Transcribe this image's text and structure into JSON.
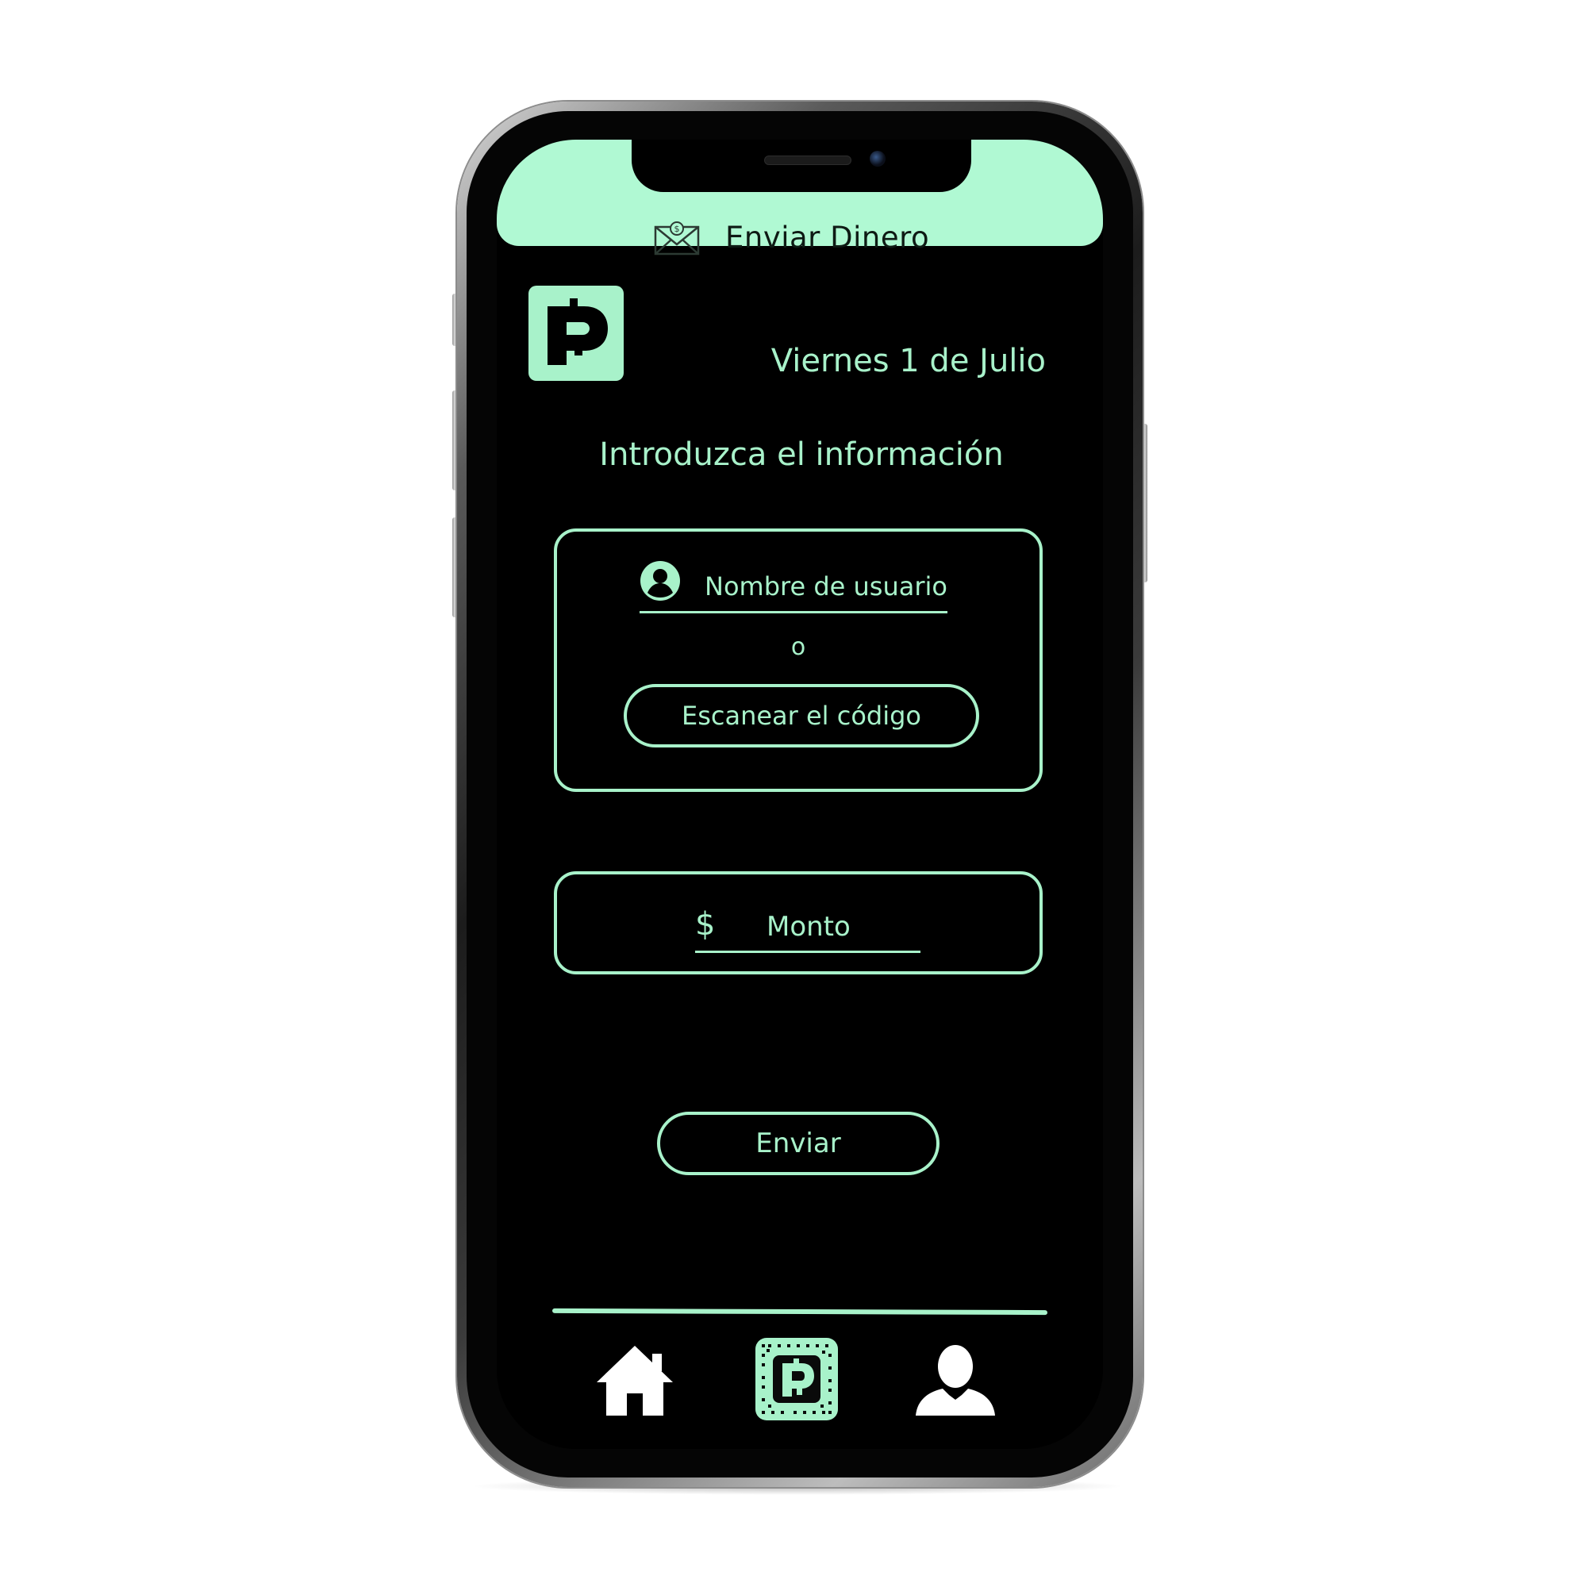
{
  "header": {
    "title": "Enviar Dinero",
    "icon": "money-envelope-icon",
    "background": "#b0f9d3"
  },
  "date": "Viernes 1 de Julio",
  "prompt": "Introduzca el información",
  "recipient": {
    "username_placeholder": "Nombre de usuario",
    "icon": "user-circle-icon",
    "separator": "o",
    "scan_button_label": "Escanear el código"
  },
  "amount": {
    "currency_symbol": "$",
    "placeholder": "Monto"
  },
  "send_button_label": "Enviar",
  "bottom_nav": {
    "items": [
      {
        "name": "home",
        "icon": "home-icon"
      },
      {
        "name": "pay",
        "icon": "pay-qr-icon",
        "active": true
      },
      {
        "name": "profile",
        "icon": "profile-icon"
      }
    ]
  },
  "colors": {
    "accent": "#a8f2ca",
    "screen_background": "#000000",
    "header_background": "#b0f9d3"
  }
}
